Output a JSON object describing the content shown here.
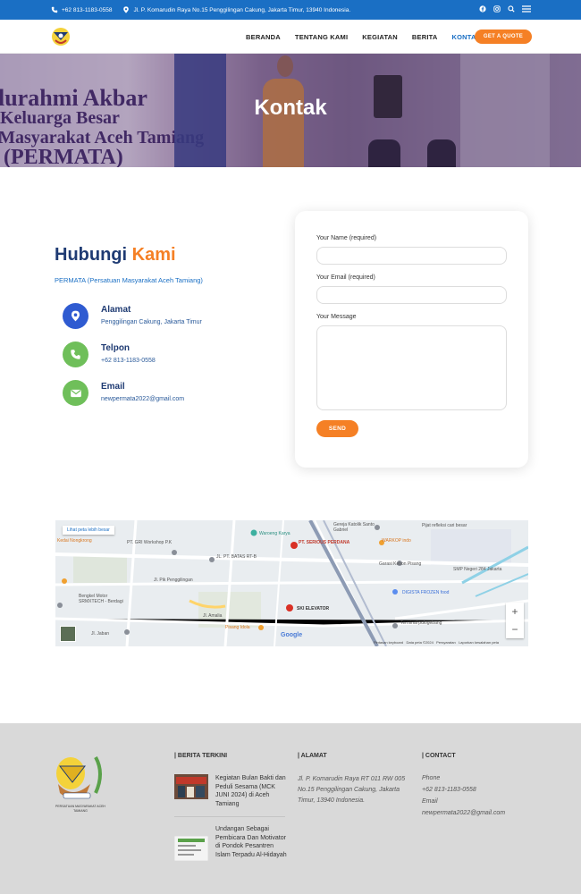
{
  "topbar": {
    "phone": "+62 813-1183-0558",
    "address": "Jl. P. Komarudin Raya No.15 Penggilingan Cakung, Jakarta Timur, 13940 Indonesia.",
    "icons": [
      "facebook-icon",
      "instagram-icon",
      "search-icon",
      "menu-icon"
    ]
  },
  "nav": {
    "items": [
      "BERANDA",
      "TENTANG KAMI",
      "KEGIATAN",
      "BERITA",
      "KONTAK"
    ],
    "active": "KONTAK",
    "cta": "GET A QUOTE"
  },
  "hero": {
    "title": "Kontak",
    "banner_lines": [
      "lurahmi Akbar",
      "Keluarga Besar",
      "n Masyarakat Aceh Tamiang",
      "(PERMATA)"
    ]
  },
  "contact": {
    "title_main": "Hubungi",
    "title_accent": "Kami",
    "subtitle": "PERMATA (Persatuan Masyarakat Aceh Tamiang)",
    "items": [
      {
        "label": "Alamat",
        "value": "Penggilingan Cakung, Jakarta Timur",
        "icon": "location-pin-icon",
        "color": "#2f5bd1"
      },
      {
        "label": "Telpon",
        "value": "+62 813-1183-0558",
        "icon": "phone-icon",
        "color": "#6fbf5a"
      },
      {
        "label": "Email",
        "value": "newpermata2022@gmail.com",
        "icon": "email-icon",
        "color": "#6fbf5a"
      }
    ]
  },
  "form": {
    "name_label": "Your Name (required)",
    "email_label": "Your Email (required)",
    "message_label": "Your Message",
    "name_value": "",
    "email_value": "",
    "message_value": "",
    "send": "SEND"
  },
  "map": {
    "larger_map_link": "Lihat peta lebih besar",
    "labels": [
      "Kedai Nongkrong",
      "PT. GRI Workshop P.K",
      "Waroeng Karya",
      "PT. SERIOUS PERDANA",
      "Gereja Katolik Santo Gabriel",
      "Pijat refleksi cari besar",
      "WARKOP indo",
      "JL. PT. BATAS RT-B",
      "Jl. Pik Penggilingan",
      "Garasi Kebon Pisang",
      "SMP Negeri 284 Jakarta",
      "Bengkel Motor SRMXTECH - Berdagi",
      "DIGISTA FROZEN food",
      "SKI ELEVATOR",
      "Pisang Idola",
      "Terminal pulogebang",
      "Jl. Jaban",
      "Jl. Amalia"
    ],
    "google": "Google",
    "footer_items": [
      "Pintasan keyboard",
      "Data peta ©2024",
      "Persyaratan",
      "Laporkan kesalahan peta"
    ],
    "zoom_in": "+",
    "zoom_out": "−"
  },
  "footer": {
    "logo_text": "PERSATUAN MASYARAKAT ACEH TAMIANG",
    "news_title": "| BERITA TERKINI",
    "news": [
      {
        "title": "Kegiatan Bulan Bakti dan Peduli Sesama (MCK JUNI 2024) di Aceh Tamiang"
      },
      {
        "title": "Undangan Sebagai Pembicara Dan Motivator di Pondok Pesantren Islam Terpadu Al-Hidayah"
      }
    ],
    "address_title": "| ALAMAT",
    "address": "Jl. P. Komarudin Raya RT 011 RW 005 No.15 Penggilingan Cakung, Jakarta Timur, 13940 Indonesia.",
    "contact_title": "| CONTACT",
    "phone_label": "Phone",
    "phone": "+62 813-1183-0558",
    "email_label": "Email",
    "email": "newpermata2022@gmail.com"
  },
  "colors": {
    "primary_blue": "#1a6fc4",
    "navy": "#1f3b73",
    "orange": "#f58025",
    "green": "#6fbf5a"
  }
}
